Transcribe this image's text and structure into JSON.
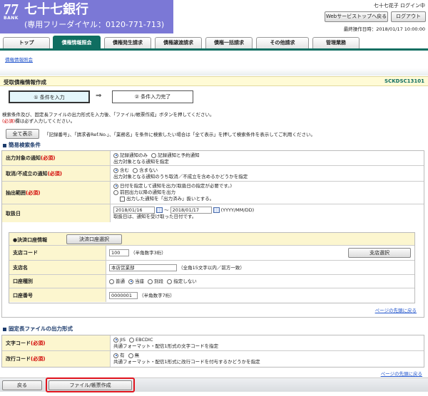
{
  "header": {
    "logo_number": "77",
    "logo_bank": "BANK",
    "bank_name": "七十七銀行",
    "freedial": "(専用フリーダイヤル：0120-771-713)",
    "user": "七十七花子 ログイン中",
    "web_top_button": "Webサービストップへ戻る",
    "logout_button": "ログアウト",
    "last_operation": "最終操作日時：2018/01/17 10:00:00"
  },
  "tabs": [
    {
      "label": "トップ"
    },
    {
      "label": "債権情報照会"
    },
    {
      "label": "債権発生請求"
    },
    {
      "label": "債権譲渡請求"
    },
    {
      "label": "債権一括請求"
    },
    {
      "label": "その他請求"
    },
    {
      "label": "管理業務"
    }
  ],
  "breadcrumb": "債権情報照会",
  "page": {
    "title": "受取債権情報作成",
    "screen_id": "SCKDSC13101"
  },
  "steps": {
    "step1": "① 条件を入力",
    "arrow": "⇒",
    "step2": "② 条件入力完了"
  },
  "instructions": {
    "line1": "検索条件及び、固定長ファイルの出力形式を入力後、「ファイル/帳票作成」ボタンを押してください。",
    "line2_req": "(必須)",
    "line2_rest": "欄は必ず入力してください。",
    "show_all_button": "全て表示",
    "show_all_note": "「記録番号」、「請求者Ref.No.」、「業務名」を条件に検索したい場合は「全て表示」を押して検索条件を表示してご利用ください。"
  },
  "simple_search": {
    "heading": "簡易検索条件",
    "output_notice": {
      "label": "出力対象の通知",
      "req": "(必須)",
      "option1": "記録通知のみ",
      "option2": "記録通知と予約通知",
      "help": "出力対象となる通知を指定"
    },
    "cancel_notice": {
      "label": "取消/不成立の通知",
      "req": "(必須)",
      "option1": "含む",
      "option2": "含まない",
      "help": "出力対象となる通知のうち取消／不成立を含めるかどうかを指定"
    },
    "extract_range": {
      "label": "抽出範囲",
      "req": "(必須)",
      "option1": "日付を指定して通知を出力(取扱日の指定が必要です。)",
      "option2": "前回出力以降の通知を出力",
      "checkbox": "出力した通知を「出力済み」扱いとする。"
    },
    "handling_date": {
      "label": "取扱日",
      "from": "2018/01/16",
      "tilde": "〜",
      "to": "2018/01/17",
      "format": "(YYYY/MM/DD)",
      "help": "取扱日は、通知を受け取った日付です。"
    },
    "settlement": {
      "heading": "●決済口座情報",
      "select_button": "決済口座選択",
      "branch_code": {
        "label": "支店コード",
        "value": "100",
        "help": "（半角数字3桁）",
        "button": "支店選択"
      },
      "branch_name": {
        "label": "支店名",
        "value": "本店営業部",
        "help": "（全角15文字以内／前方一致）"
      },
      "account_type": {
        "label": "口座種別",
        "option1": "普通",
        "option2": "当座",
        "option3": "別段",
        "option4": "指定しない"
      },
      "account_number": {
        "label": "口座番号",
        "value": "0000001",
        "help": "（半角数字7桁）"
      }
    },
    "page_top_link": "ページの先頭に戻る"
  },
  "output_format": {
    "heading": "固定長ファイルの出力形式",
    "char_code": {
      "label": "文字コード",
      "req": "(必須)",
      "option1": "JIS",
      "option2": "EBCDIC",
      "help": "共通フォーマット・配信1形式の文字コードを指定"
    },
    "newline": {
      "label": "改行コード",
      "req": "(必須)",
      "option1": "有",
      "option2": "無",
      "help": "共通フォーマット・配信1形式に改行コードを付与するかどうかを指定"
    },
    "page_top_link": "ページの先頭に戻る"
  },
  "footer": {
    "back_button": "戻る",
    "create_button": "ファイル/帳票作成"
  }
}
